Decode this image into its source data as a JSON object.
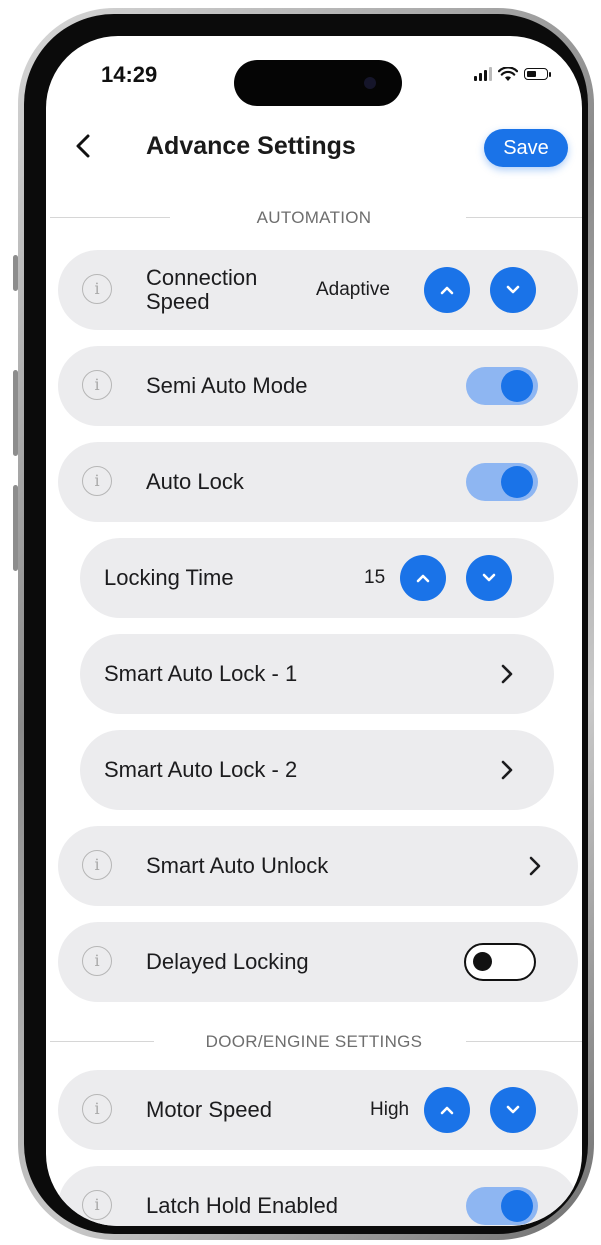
{
  "status_bar": {
    "time": "14:29"
  },
  "header": {
    "back_icon": "chevron-left-icon",
    "title": "Advance Settings",
    "save_label": "Save"
  },
  "colors": {
    "accent": "#1a73e8",
    "toggle_track_on": "#8eb6f2",
    "row_bg": "#ececee"
  },
  "sections": {
    "automation": "AUTOMATION",
    "door_engine": "DOOR/ENGINE SETTINGS"
  },
  "rows": {
    "connection_speed": {
      "label": "Connection Speed",
      "value": "Adaptive"
    },
    "semi_auto_mode": {
      "label": "Semi Auto Mode",
      "enabled": true
    },
    "auto_lock": {
      "label": "Auto Lock",
      "enabled": true
    },
    "locking_time": {
      "label": "Locking Time",
      "value": "15"
    },
    "smart_auto_lock_1": {
      "label": "Smart Auto Lock - 1"
    },
    "smart_auto_lock_2": {
      "label": "Smart Auto Lock - 2"
    },
    "smart_auto_unlock": {
      "label": "Smart Auto Unlock"
    },
    "delayed_locking": {
      "label": "Delayed Locking",
      "enabled": false
    },
    "motor_speed": {
      "label": "Motor Speed",
      "value": "High"
    },
    "latch_hold_enabled": {
      "label": "Latch Hold Enabled",
      "enabled": true
    }
  }
}
